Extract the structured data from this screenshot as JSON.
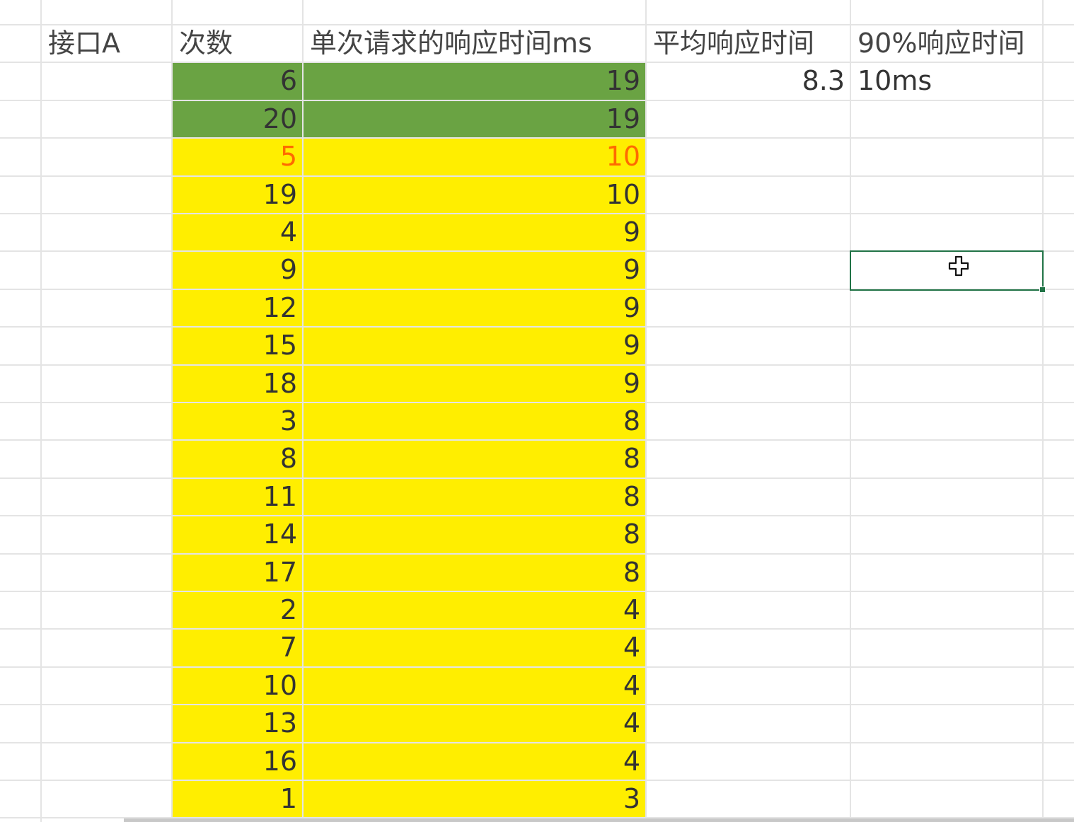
{
  "headers": {
    "interface": "接口A",
    "count": "次数",
    "single_time": "单次请求的响应时间ms",
    "avg_time": "平均响应时间",
    "p90_time": "90%响应时间"
  },
  "summary": {
    "avg_value": "8.3",
    "p90_value": "10ms"
  },
  "colors": {
    "green_fill": "#6aa343",
    "yellow_fill": "#ffee00",
    "highlight_text": "#ff6a00",
    "selection_border": "#217346"
  },
  "rows": [
    {
      "count": "6",
      "time": "19",
      "fill": "green",
      "highlight": false
    },
    {
      "count": "20",
      "time": "19",
      "fill": "green",
      "highlight": false
    },
    {
      "count": "5",
      "time": "10",
      "fill": "yellow",
      "highlight": true
    },
    {
      "count": "19",
      "time": "10",
      "fill": "yellow",
      "highlight": false
    },
    {
      "count": "4",
      "time": "9",
      "fill": "yellow",
      "highlight": false
    },
    {
      "count": "9",
      "time": "9",
      "fill": "yellow",
      "highlight": false
    },
    {
      "count": "12",
      "time": "9",
      "fill": "yellow",
      "highlight": false
    },
    {
      "count": "15",
      "time": "9",
      "fill": "yellow",
      "highlight": false
    },
    {
      "count": "18",
      "time": "9",
      "fill": "yellow",
      "highlight": false
    },
    {
      "count": "3",
      "time": "8",
      "fill": "yellow",
      "highlight": false
    },
    {
      "count": "8",
      "time": "8",
      "fill": "yellow",
      "highlight": false
    },
    {
      "count": "11",
      "time": "8",
      "fill": "yellow",
      "highlight": false
    },
    {
      "count": "14",
      "time": "8",
      "fill": "yellow",
      "highlight": false
    },
    {
      "count": "17",
      "time": "8",
      "fill": "yellow",
      "highlight": false
    },
    {
      "count": "2",
      "time": "4",
      "fill": "yellow",
      "highlight": false
    },
    {
      "count": "7",
      "time": "4",
      "fill": "yellow",
      "highlight": false
    },
    {
      "count": "10",
      "time": "4",
      "fill": "yellow",
      "highlight": false
    },
    {
      "count": "13",
      "time": "4",
      "fill": "yellow",
      "highlight": false
    },
    {
      "count": "16",
      "time": "4",
      "fill": "yellow",
      "highlight": false
    },
    {
      "count": "1",
      "time": "3",
      "fill": "yellow",
      "highlight": false
    }
  ],
  "icons": {
    "cursor": "plus-cursor-icon"
  }
}
